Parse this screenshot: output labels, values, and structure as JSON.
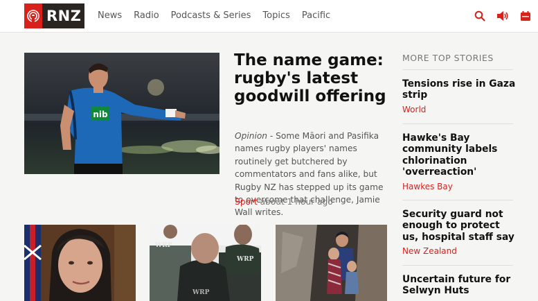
{
  "brand": {
    "logo_text": "RNZ"
  },
  "nav": {
    "items": [
      "News",
      "Radio",
      "Podcasts & Series",
      "Topics",
      "Pacific"
    ]
  },
  "header_icons": [
    "search-icon",
    "volume-icon",
    "calendar-icon"
  ],
  "colors": {
    "brand_red": "#d9211c",
    "logo_dark": "#2a2521",
    "page_bg": "#f5f5f4"
  },
  "lead": {
    "title": "The name game: rugby's latest goodwill offering",
    "summary_label": "Opinion",
    "summary": " - Some Māori and Pasifika names rugby players' names routinely get butchered by commentators and fans alike, but Rugby NZ has stepped up its game to overcome that challenge, Jamie Wall writes.",
    "tag": "Sport",
    "time": " about 1 hour ago",
    "jersey_logo": "nib"
  },
  "more": {
    "heading": "MORE TOP STORIES",
    "stories": [
      {
        "title": "Tensions rise in Gaza strip",
        "tag": "World"
      },
      {
        "title": "Hawke's Bay community labels chlorination 'overreaction'",
        "tag": "Hawkes Bay"
      },
      {
        "title": "Security guard not enough to protect us, hospital staff say",
        "tag": "New Zealand"
      },
      {
        "title": "Uncertain future for Selwyn Huts",
        "tag": ""
      }
    ]
  },
  "thumbs": {
    "vest_text": "WRP"
  }
}
